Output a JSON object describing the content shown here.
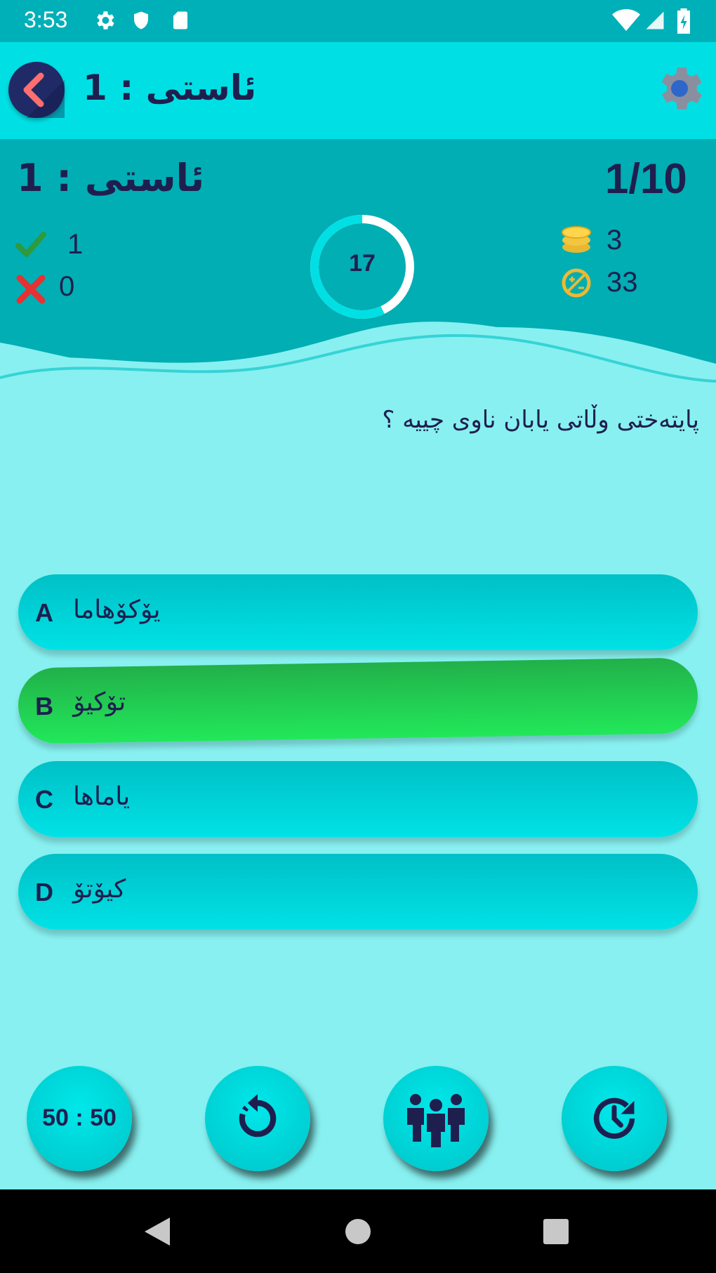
{
  "status_bar": {
    "time": "3:53",
    "icons": [
      "gear-icon",
      "shield-icon",
      "sd-card-icon",
      "wifi-icon",
      "signal-icon",
      "battery-charging-icon"
    ]
  },
  "app_bar": {
    "title": "ئاستی : 1",
    "back_icon": "chevron-left-icon",
    "settings_icon": "gear-icon"
  },
  "header": {
    "level_title": "ئاستی : 1",
    "progress": "1/10",
    "correct_count": "1",
    "wrong_count": "0",
    "coins": "3",
    "score": "33",
    "timer": "17",
    "timer_remaining_fraction": 0.57
  },
  "question": "پایتەختی وڵاتی یابان ناوی چییە ؟",
  "answers": [
    {
      "letter": "A",
      "text": "یۆکۆهاما",
      "state": "normal"
    },
    {
      "letter": "B",
      "text": "تۆکیۆ",
      "state": "correct"
    },
    {
      "letter": "C",
      "text": "یاماها",
      "state": "normal"
    },
    {
      "letter": "D",
      "text": "کیۆتۆ",
      "state": "normal"
    }
  ],
  "lifelines": [
    {
      "label": "50 : 50",
      "icon": "fifty-fifty"
    },
    {
      "label": "",
      "icon": "refresh-icon"
    },
    {
      "label": "",
      "icon": "people-icon"
    },
    {
      "label": "",
      "icon": "time-add-icon"
    }
  ],
  "colors": {
    "accent": "#00e0e4",
    "header": "#00aab0",
    "background": "#88f0f0",
    "correct": "#22d050",
    "text": "#1f1f4f"
  }
}
